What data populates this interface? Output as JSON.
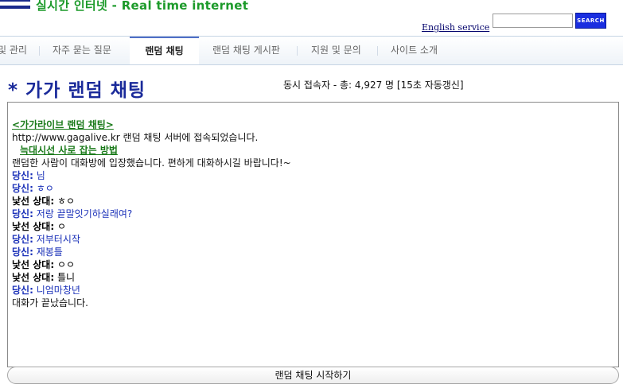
{
  "header": {
    "site_title": "실시간 인터넷 - Real time internet",
    "english_link": "English service",
    "search": {
      "value": "",
      "placeholder": ""
    },
    "search_button": "SEARCH"
  },
  "nav": {
    "items": [
      {
        "label": "및 관리"
      },
      {
        "label": "자주 묻는 질문"
      },
      {
        "label": "랜덤 채팅",
        "active": true
      },
      {
        "label": "랜덤 채팅 게시판"
      },
      {
        "label": "지원 및 문의"
      },
      {
        "label": "사이트 소개"
      }
    ]
  },
  "page_title": "* 가가 랜덤 채팅",
  "concurrent_users": "동시 접속자 - 총: 4,927 명 [15초 자동갱신]",
  "chat": {
    "link1": "<가가라이브 랜덤 채팅>",
    "connect_msg": "http://www.gagalive.kr 랜덤 채팅 서버에 접속되었습니다.",
    "link2": "늑대시선 사로 잡는 방법",
    "welcome_msg": "랜덤한 사람이 대화방에 입장했습니다. 편하게 대화하시길 바랍니다!~",
    "me_label": "당신:",
    "other_label": "낯선 상대:",
    "messages": [
      {
        "who": "me",
        "text": " 님"
      },
      {
        "who": "me",
        "text": " ㅎㅇ"
      },
      {
        "who": "other",
        "text": " ㅎㅇ"
      },
      {
        "who": "me",
        "text": " 저랑 끝말잇기하실래여?"
      },
      {
        "who": "other",
        "text": " ㅇ"
      },
      {
        "who": "me",
        "text": " 저부터시작"
      },
      {
        "who": "me",
        "text": " 재봉틀"
      },
      {
        "who": "other",
        "text": " ㅇㅇ"
      },
      {
        "who": "other",
        "text": " 틀니"
      },
      {
        "who": "me",
        "text": " 니엄마창년"
      }
    ],
    "end_msg": "대화가 끝났습니다."
  },
  "start_button": "랜덤 채팅 시작하기",
  "colors": {
    "brand_green": "#1c9a2a",
    "title_blue": "#1a2a9a",
    "me_blue": "#1a30b8",
    "search_button_blue": "#1a2ee0"
  }
}
